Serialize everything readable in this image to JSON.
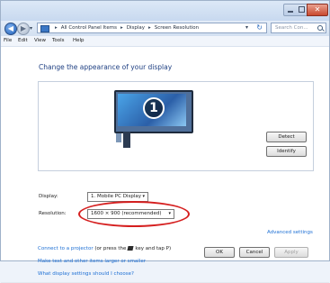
{
  "titlebar": {
    "close_symbol": "✕"
  },
  "nav": {
    "back_symbol": "◀",
    "forward_symbol": "▶",
    "dropdown_symbol": "▾",
    "breadcrumb": [
      "All Control Panel Items",
      "Display",
      "Screen Resolution"
    ],
    "breadcrumb_sep": "▸",
    "refresh_symbol": "↻",
    "search_placeholder": "Search Con..."
  },
  "menu": [
    "File",
    "Edit",
    "View",
    "Tools",
    "Help"
  ],
  "main": {
    "heading": "Change the appearance of your display",
    "monitor_number": "1",
    "detect_label": "Detect",
    "identify_label": "Identify",
    "display_label": "Display:",
    "display_value": "1. Mobile PC Display",
    "resolution_label": "Resolution:",
    "resolution_value": "1600 × 900 (recommended)",
    "advanced_link": "Advanced settings",
    "link_projector": "Connect to a projector",
    "link_projector_hint_a": "(or press the",
    "link_projector_hint_b": "key and tap P)",
    "link_text_size": "Make text and other items larger or smaller",
    "link_settings": "What display settings should I choose?"
  },
  "footer": {
    "ok": "OK",
    "cancel": "Cancel",
    "apply": "Apply"
  },
  "colors": {
    "accent_link": "#1d6fd4",
    "heading": "#1e3f82",
    "highlight": "#d51f1f"
  }
}
